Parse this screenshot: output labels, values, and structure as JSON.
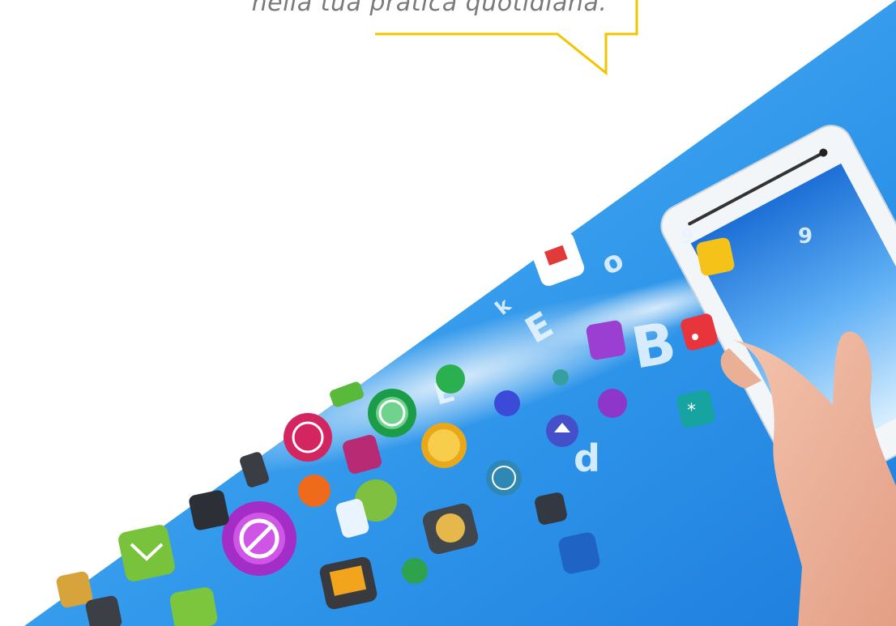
{
  "speech_bubble": {
    "text": "nella tua pratica quotidiana.",
    "border_color": "#f2c500"
  },
  "photo": {
    "background_color": "#3aa0ee",
    "icons": [
      "yellow-app-icon",
      "red-rss-icon",
      "purple-grid-icon",
      "teal-star-icon",
      "green-clock-icon",
      "purple-no-entry-icon",
      "pink-globe-icon",
      "green-envelope-icon",
      "orange-cart-icon",
      "green-puzzle-icon",
      "blue-phone-icon",
      "gray-compass-icon",
      "blue-upload-icon",
      "red-news-icon"
    ]
  }
}
